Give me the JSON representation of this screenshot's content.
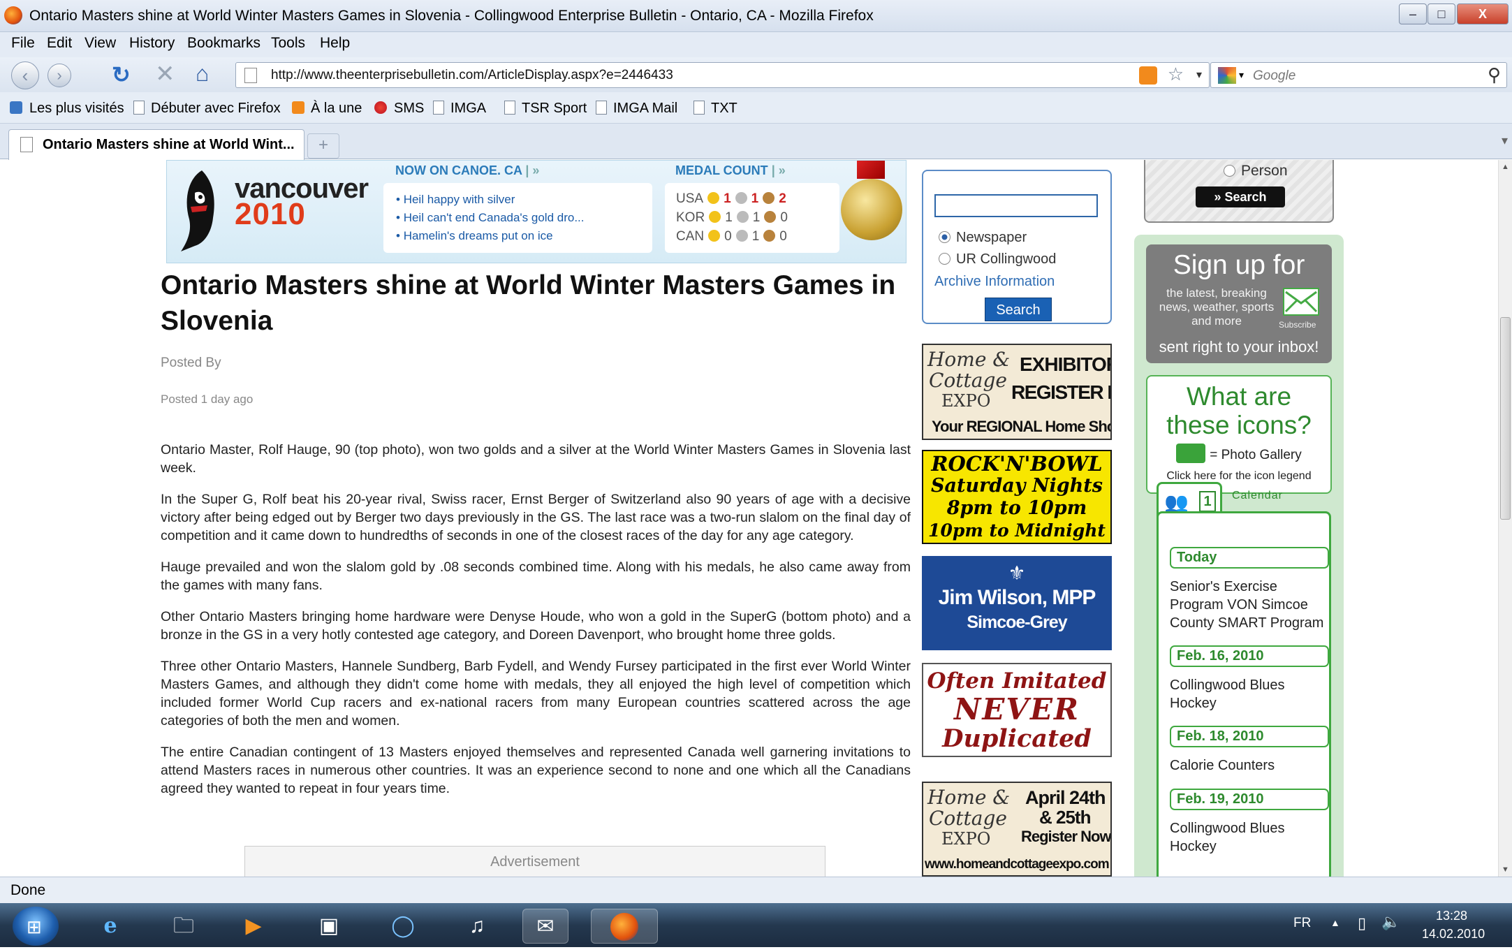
{
  "window": {
    "title": "Ontario Masters shine at World Winter Masters Games in Slovenia - Collingwood Enterprise Bulletin - Ontario, CA - Mozilla Firefox",
    "minimize": "–",
    "maximize": "□",
    "close": "X"
  },
  "menu": [
    "File",
    "Edit",
    "View",
    "History",
    "Bookmarks",
    "Tools",
    "Help"
  ],
  "nav": {
    "url": "http://www.theenterprisebulletin.com/ArticleDisplay.aspx?e=2446433",
    "search_placeholder": "Google"
  },
  "bookmarks": [
    "Les plus visités",
    "Débuter avec Firefox",
    "À la une",
    "SMS",
    "IMGA",
    "TSR Sport",
    "IMGA Mail",
    "TXT"
  ],
  "tab": {
    "label": "Ontario Masters shine at World Wint..."
  },
  "olympics": {
    "logo_word": "vancouver",
    "logo_year": "2010",
    "canoe_header": "NOW ON CANOE. CA",
    "canoe_items": [
      "Heil happy with silver",
      "Heil can't end Canada's gold dro...",
      "Hamelin's dreams put on ice"
    ],
    "medal_header": "MEDAL COUNT",
    "medals": [
      {
        "country": "USA",
        "gold": "1",
        "silver": "1",
        "bronze": "2"
      },
      {
        "country": "KOR",
        "gold": "1",
        "silver": "1",
        "bronze": "0"
      },
      {
        "country": "CAN",
        "gold": "0",
        "silver": "1",
        "bronze": "0"
      }
    ]
  },
  "article": {
    "title": "Ontario Masters shine at World Winter Masters Games in Slovenia",
    "posted_by": "Posted By",
    "posted_ago": "Posted 1 day ago",
    "paragraphs": [
      "Ontario Master, Rolf Hauge, 90 (top photo), won two golds and a silver at the World Winter Masters Games in Slovenia last week.",
      "In the Super G, Rolf beat his 20-year rival, Swiss racer, Ernst Berger of Switzerland also 90 years of age with a decisive victory after being edged out by Berger two days previously in the GS. The last race was a two-run slalom on the final day of competition and it came down to hundredths of seconds in one of the closest races of the day for any age category.",
      "Hauge prevailed and won the slalom gold by .08 seconds combined time. Along with his medals, he also came away from the games with many fans.",
      "Other Ontario Masters bringing home hardware were Denyse Houde, who won a gold in the SuperG (bottom photo) and a bronze in the GS in a very hotly contested age category, and Doreen Davenport, who brought home three golds.",
      "Three other Ontario Masters, Hannele Sundberg, Barb Fydell, and Wendy Fursey participated in the first ever World Winter Masters Games, and although they didn't come home with medals, they all enjoyed the high level of competition which included former World Cup racers and ex-national racers from many European countries scattered across the age categories of both the men and women.",
      "The entire Canadian contingent of 13 Masters enjoyed themselves and represented Canada well garnering invitations to attend Masters races in numerous other countries. It was an experience second to none and one which all the Canadians agreed they wanted to repeat in four years time."
    ],
    "advertisement": "Advertisement"
  },
  "site_search": {
    "option_newspaper": "Newspaper",
    "option_ur": "UR Collingwood",
    "archive": "Archive Information",
    "button": "Search"
  },
  "ads": {
    "expo1_logo_home": "Home &",
    "expo1_logo_cottage": "Cottage",
    "expo1_logo_expo": "EXPO",
    "expo1_line1": "EXHIBITORS",
    "expo1_line2": "REGISTER NOW!",
    "expo1_line3": "Your REGIONAL Home Show",
    "rock1": "ROCK'N'BOWL",
    "rock2": "Saturday Nights",
    "rock3": "8pm to 10pm",
    "rock4": "10pm to Midnight",
    "mpp1": "Jim Wilson, MPP",
    "mpp2": "Simcoe-Grey",
    "imit1": "Often Imitated",
    "imit2": "NEVER",
    "imit3": "Duplicated",
    "expo2_logo_home": "Home &",
    "expo2_logo_cottage": "Cottage",
    "expo2_logo_expo": "EXPO",
    "expo2_line1": "April 24th",
    "expo2_line2": "& 25th",
    "expo2_line3": "Register Now!",
    "expo2_line4": "www.homeandcottageexpo.com"
  },
  "sidebar": {
    "person": "Person",
    "search_btn": "Search",
    "signup_title": "Sign up for",
    "signup_body": "the latest, breaking news, weather, sports and more",
    "signup_subscribe": "Subscribe",
    "signup_foot": "sent right to your inbox!",
    "icons_title": "What are these icons?",
    "icons_photo": "= Photo Gallery",
    "icons_legend": "Click here for the icon legend",
    "calendar_tab": "Calendar",
    "calendar_num": "1",
    "calendar": [
      {
        "date": "Today",
        "event": "Senior's Exercise Program VON Simcoe County SMART Program"
      },
      {
        "date": "Feb. 16, 2010",
        "event": "Collingwood Blues Hockey"
      },
      {
        "date": "Feb. 18, 2010",
        "event": "Calorie Counters"
      },
      {
        "date": "Feb. 19, 2010",
        "event": "Collingwood Blues Hockey"
      }
    ]
  },
  "status": {
    "text": "Done"
  },
  "taskbar": {
    "lang": "FR",
    "time": "13:28",
    "date": "14.02.2010"
  },
  "colors": {
    "link_blue": "#2f6db4",
    "search_blue": "#1a61b4",
    "sidebar_green": "#cfe8cf",
    "calendar_green": "#3fa83f"
  }
}
